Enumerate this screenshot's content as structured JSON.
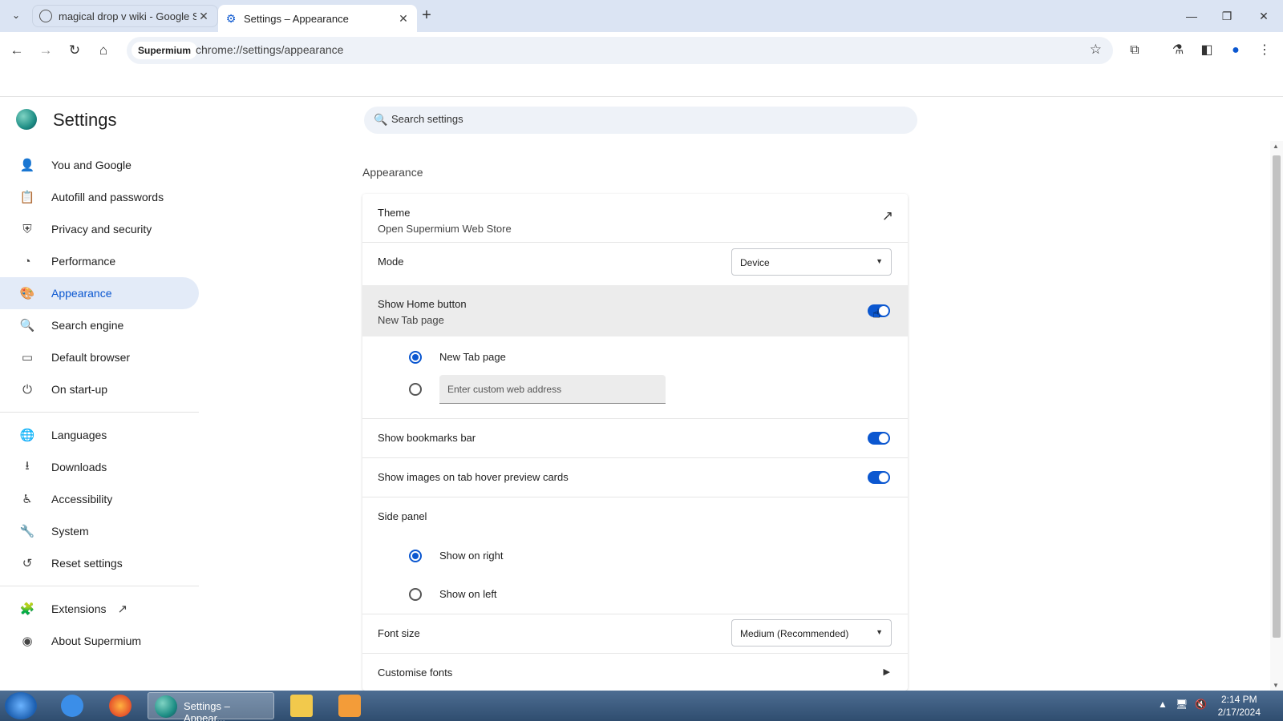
{
  "tabs": [
    {
      "title": "magical drop v wiki - Google S",
      "active": false
    },
    {
      "title": "Settings – Appearance",
      "active": true
    }
  ],
  "window_controls": {
    "minimize": "—",
    "restore": "❐",
    "close": "✕"
  },
  "toolbar": {
    "chip": "Supermium",
    "url": "chrome://settings/appearance"
  },
  "settings": {
    "title": "Settings",
    "search_placeholder": "Search settings"
  },
  "sidebar": {
    "items": [
      {
        "label": "You and Google",
        "icon": "person-icon"
      },
      {
        "label": "Autofill and passwords",
        "icon": "clipboard-icon"
      },
      {
        "label": "Privacy and security",
        "icon": "shield-icon"
      },
      {
        "label": "Performance",
        "icon": "gauge-icon"
      },
      {
        "label": "Appearance",
        "icon": "palette-icon",
        "selected": true
      },
      {
        "label": "Search engine",
        "icon": "search-icon"
      },
      {
        "label": "Default browser",
        "icon": "browser-icon"
      },
      {
        "label": "On start-up",
        "icon": "power-icon"
      }
    ],
    "items2": [
      {
        "label": "Languages",
        "icon": "globe-icon"
      },
      {
        "label": "Downloads",
        "icon": "download-icon"
      },
      {
        "label": "Accessibility",
        "icon": "accessibility-icon"
      },
      {
        "label": "System",
        "icon": "wrench-icon"
      },
      {
        "label": "Reset settings",
        "icon": "history-icon"
      }
    ],
    "items3": [
      {
        "label": "Extensions",
        "icon": "puzzle-icon"
      },
      {
        "label": "About Supermium",
        "icon": "supermium-icon"
      }
    ]
  },
  "appearance": {
    "section_title": "Appearance",
    "theme": {
      "label": "Theme",
      "sub": "Open Supermium Web Store"
    },
    "mode": {
      "label": "Mode",
      "value": "Device"
    },
    "home_button": {
      "label": "Show Home button",
      "sub": "New Tab page",
      "enabled": true
    },
    "home_options": {
      "new_tab": "New Tab page",
      "custom_placeholder": "Enter custom web address"
    },
    "bookmarks_bar": {
      "label": "Show bookmarks bar",
      "enabled": true
    },
    "tab_hover": {
      "label": "Show images on tab hover preview cards",
      "enabled": true
    },
    "side_panel": {
      "label": "Side panel",
      "right": "Show on right",
      "left": "Show on left"
    },
    "font_size": {
      "label": "Font size",
      "value": "Medium (Recommended)"
    },
    "customise_fonts": {
      "label": "Customise fonts"
    }
  },
  "taskbar": {
    "active_app": "Settings – Appear...",
    "time": "2:14 PM",
    "date": "2/17/2024"
  }
}
